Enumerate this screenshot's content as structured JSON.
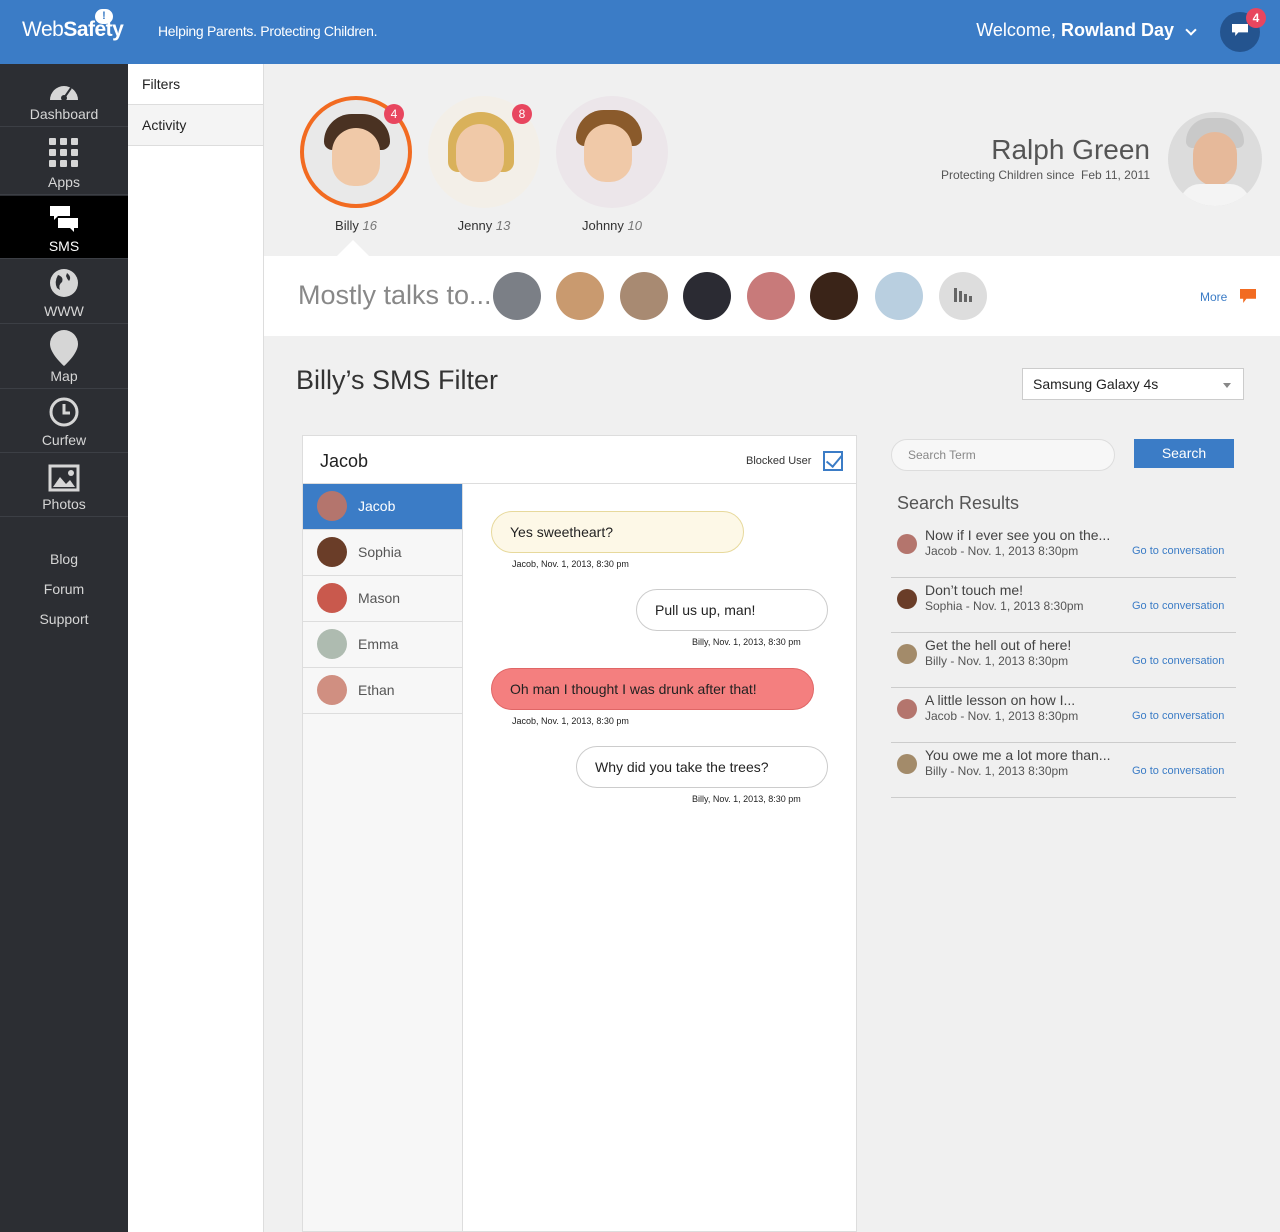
{
  "header": {
    "logo_text_regular": "Web",
    "logo_text_bold": "Safety",
    "logo_bubble": "!",
    "tagline": "Helping Parents. Protecting Children.",
    "welcome_prefix": "Welcome,",
    "user_name": "Rowland Day",
    "notifications_count": "4"
  },
  "leftnav": {
    "items": [
      {
        "label": "Dashboard",
        "icon": "dashboard-gauge-icon"
      },
      {
        "label": "Apps",
        "icon": "apps-grid-icon"
      },
      {
        "label": "SMS",
        "icon": "sms-bubbles-icon"
      },
      {
        "label": "WWW",
        "icon": "globe-icon"
      },
      {
        "label": "Map",
        "icon": "map-pin-icon"
      },
      {
        "label": "Curfew",
        "icon": "clock-icon"
      },
      {
        "label": "Photos",
        "icon": "photo-icon"
      }
    ],
    "links": [
      "Blog",
      "Forum",
      "Support"
    ]
  },
  "subnav": {
    "items": [
      "Filters",
      "Activity"
    ]
  },
  "children": [
    {
      "name": "Billy",
      "age": "16",
      "badge": "4"
    },
    {
      "name": "Jenny",
      "age": "13",
      "badge": "8"
    },
    {
      "name": "Johnny",
      "age": "10",
      "badge": ""
    }
  ],
  "parent": {
    "name": "Ralph Green",
    "since_label": "Protecting Children since",
    "since_date": "Feb 11, 2011"
  },
  "talks": {
    "title": "Mostly talks to...",
    "more_label": "More"
  },
  "page_title": "Billy’s SMS Filter",
  "device_select": {
    "selected": "Samsung Galaxy 4s"
  },
  "conversation": {
    "contact_name": "Jacob",
    "blocked_label": "Blocked User",
    "blocked_checked": true,
    "contacts": [
      "Jacob",
      "Sophia",
      "Mason",
      "Emma",
      "Ethan"
    ],
    "messages": [
      {
        "text": "Yes sweetheart?",
        "meta": "Jacob, Nov. 1, 2013, 8:30 pm",
        "side": "left"
      },
      {
        "text": "Pull us up, man!",
        "meta": "Billy, Nov. 1, 2013, 8:30 pm",
        "side": "right"
      },
      {
        "text": "Oh man I thought I was drunk after that!",
        "meta": "Jacob, Nov. 1, 2013, 8:30 pm",
        "side": "left",
        "flagged": true
      },
      {
        "text": "Why did you take the trees?",
        "meta": "Billy, Nov. 1, 2013, 8:30 pm",
        "side": "right"
      }
    ]
  },
  "search": {
    "placeholder": "Search Term",
    "button_label": "Search",
    "results_title": "Search Results",
    "go_label": "Go to conversation",
    "results": [
      {
        "snippet": "Now if I ever see you on  the...",
        "meta": "Jacob - Nov. 1, 2013 8:30pm"
      },
      {
        "snippet": "Don’t touch me!",
        "meta": "Sophia - Nov. 1, 2013 8:30pm"
      },
      {
        "snippet": "Get the hell out of here!",
        "meta": "Billy - Nov. 1, 2013 8:30pm"
      },
      {
        "snippet": "A little lesson on how I...",
        "meta": "Jacob - Nov. 1, 2013 8:30pm"
      },
      {
        "snippet": "You owe me a lot more than...",
        "meta": "Billy - Nov. 1, 2013 8:30pm"
      }
    ]
  },
  "colors": {
    "brand_blue": "#3b7cc6",
    "accent_orange": "#f26b21",
    "badge_red": "#e8465f"
  }
}
